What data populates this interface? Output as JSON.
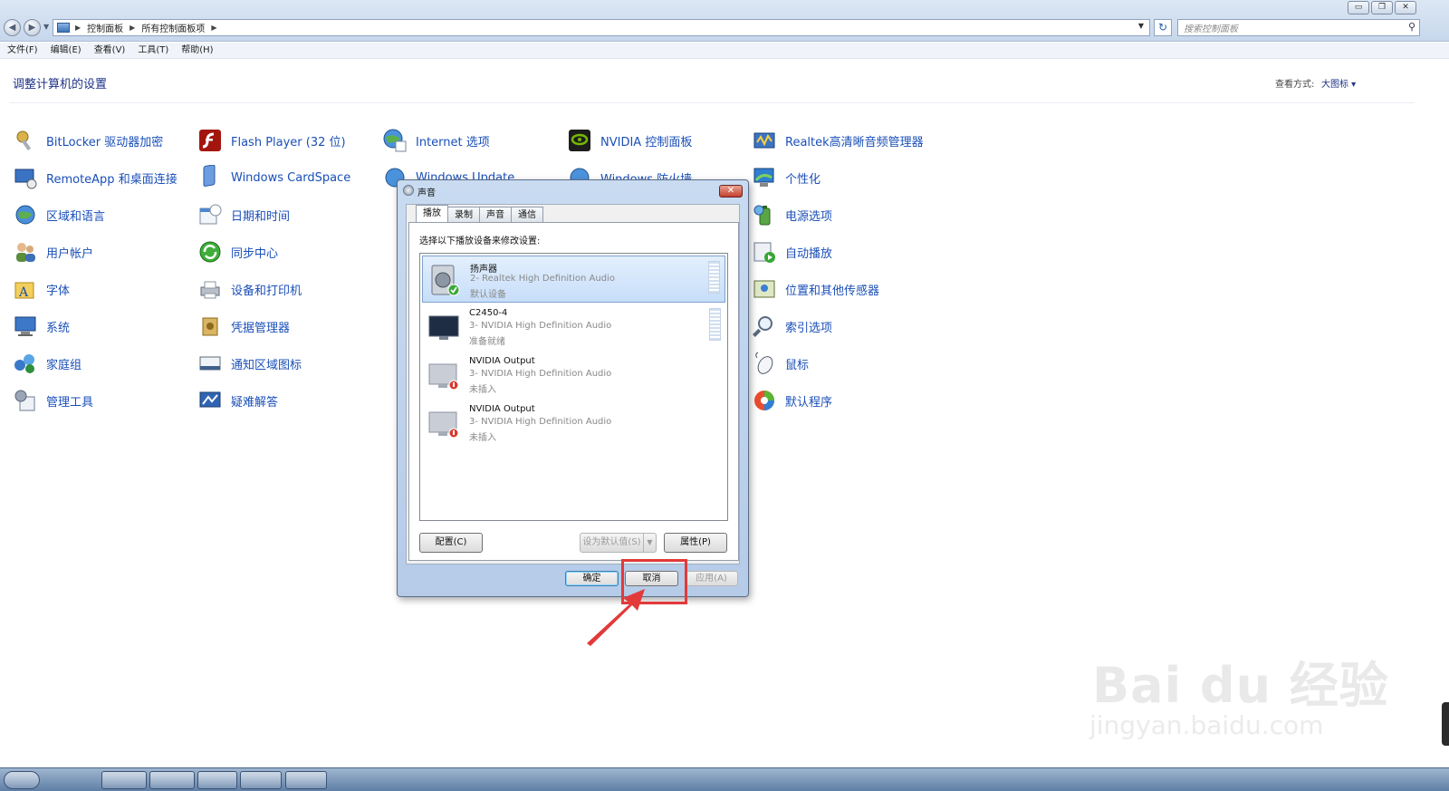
{
  "address": {
    "breadcrumbs": [
      "控制面板",
      "所有控制面板项"
    ],
    "search_placeholder": "搜索控制面板"
  },
  "menubar": [
    "文件(F)",
    "编辑(E)",
    "查看(V)",
    "工具(T)",
    "帮助(H)"
  ],
  "header": {
    "title": "调整计算机的设置",
    "view_by_label": "查看方式:",
    "view_by_value": "大图标 ▾"
  },
  "items": {
    "col1": [
      "BitLocker 驱动器加密",
      "RemoteApp 和桌面连接",
      "区域和语言",
      "用户帐户",
      "字体",
      "系统",
      "家庭组",
      "管理工具"
    ],
    "col2": [
      "Flash Player (32 位)",
      "Windows CardSpace",
      "日期和时间",
      "同步中心",
      "设备和打印机",
      "凭据管理器",
      "通知区域图标",
      "疑难解答"
    ],
    "col3": [
      "Internet 选项",
      "Windows Update"
    ],
    "col4": [
      "NVIDIA 控制面板",
      "Windows 防火墙"
    ],
    "col5": [
      "Realtek高清晰音频管理器",
      "个性化",
      "电源选项",
      "自动播放",
      "位置和其他传感器",
      "索引选项",
      "鼠标",
      "默认程序"
    ]
  },
  "dialog": {
    "title": "声音",
    "tabs": [
      "播放",
      "录制",
      "声音",
      "通信"
    ],
    "hint": "选择以下播放设备来修改设置:",
    "devices": [
      {
        "name": "扬声器",
        "desc": "2- Realtek High Definition Audio",
        "status": "默认设备"
      },
      {
        "name": "C2450-4",
        "desc": "3- NVIDIA High Definition Audio",
        "status": "准备就绪"
      },
      {
        "name": "NVIDIA Output",
        "desc": "3- NVIDIA High Definition Audio",
        "status": "未插入"
      },
      {
        "name": "NVIDIA Output",
        "desc": "3- NVIDIA High Definition Audio",
        "status": "未插入"
      }
    ],
    "buttons": {
      "configure": "配置(C)",
      "set_default": "设为默认值(S)",
      "properties": "属性(P)",
      "ok": "确定",
      "cancel": "取消",
      "apply": "应用(A)"
    }
  },
  "watermark": {
    "main": "Bai du 经验",
    "sub": "jingyan.baidu.com"
  },
  "colors": {
    "link": "#1a4fb8",
    "title": "#1e3287",
    "highlight": "#e23a3a"
  }
}
